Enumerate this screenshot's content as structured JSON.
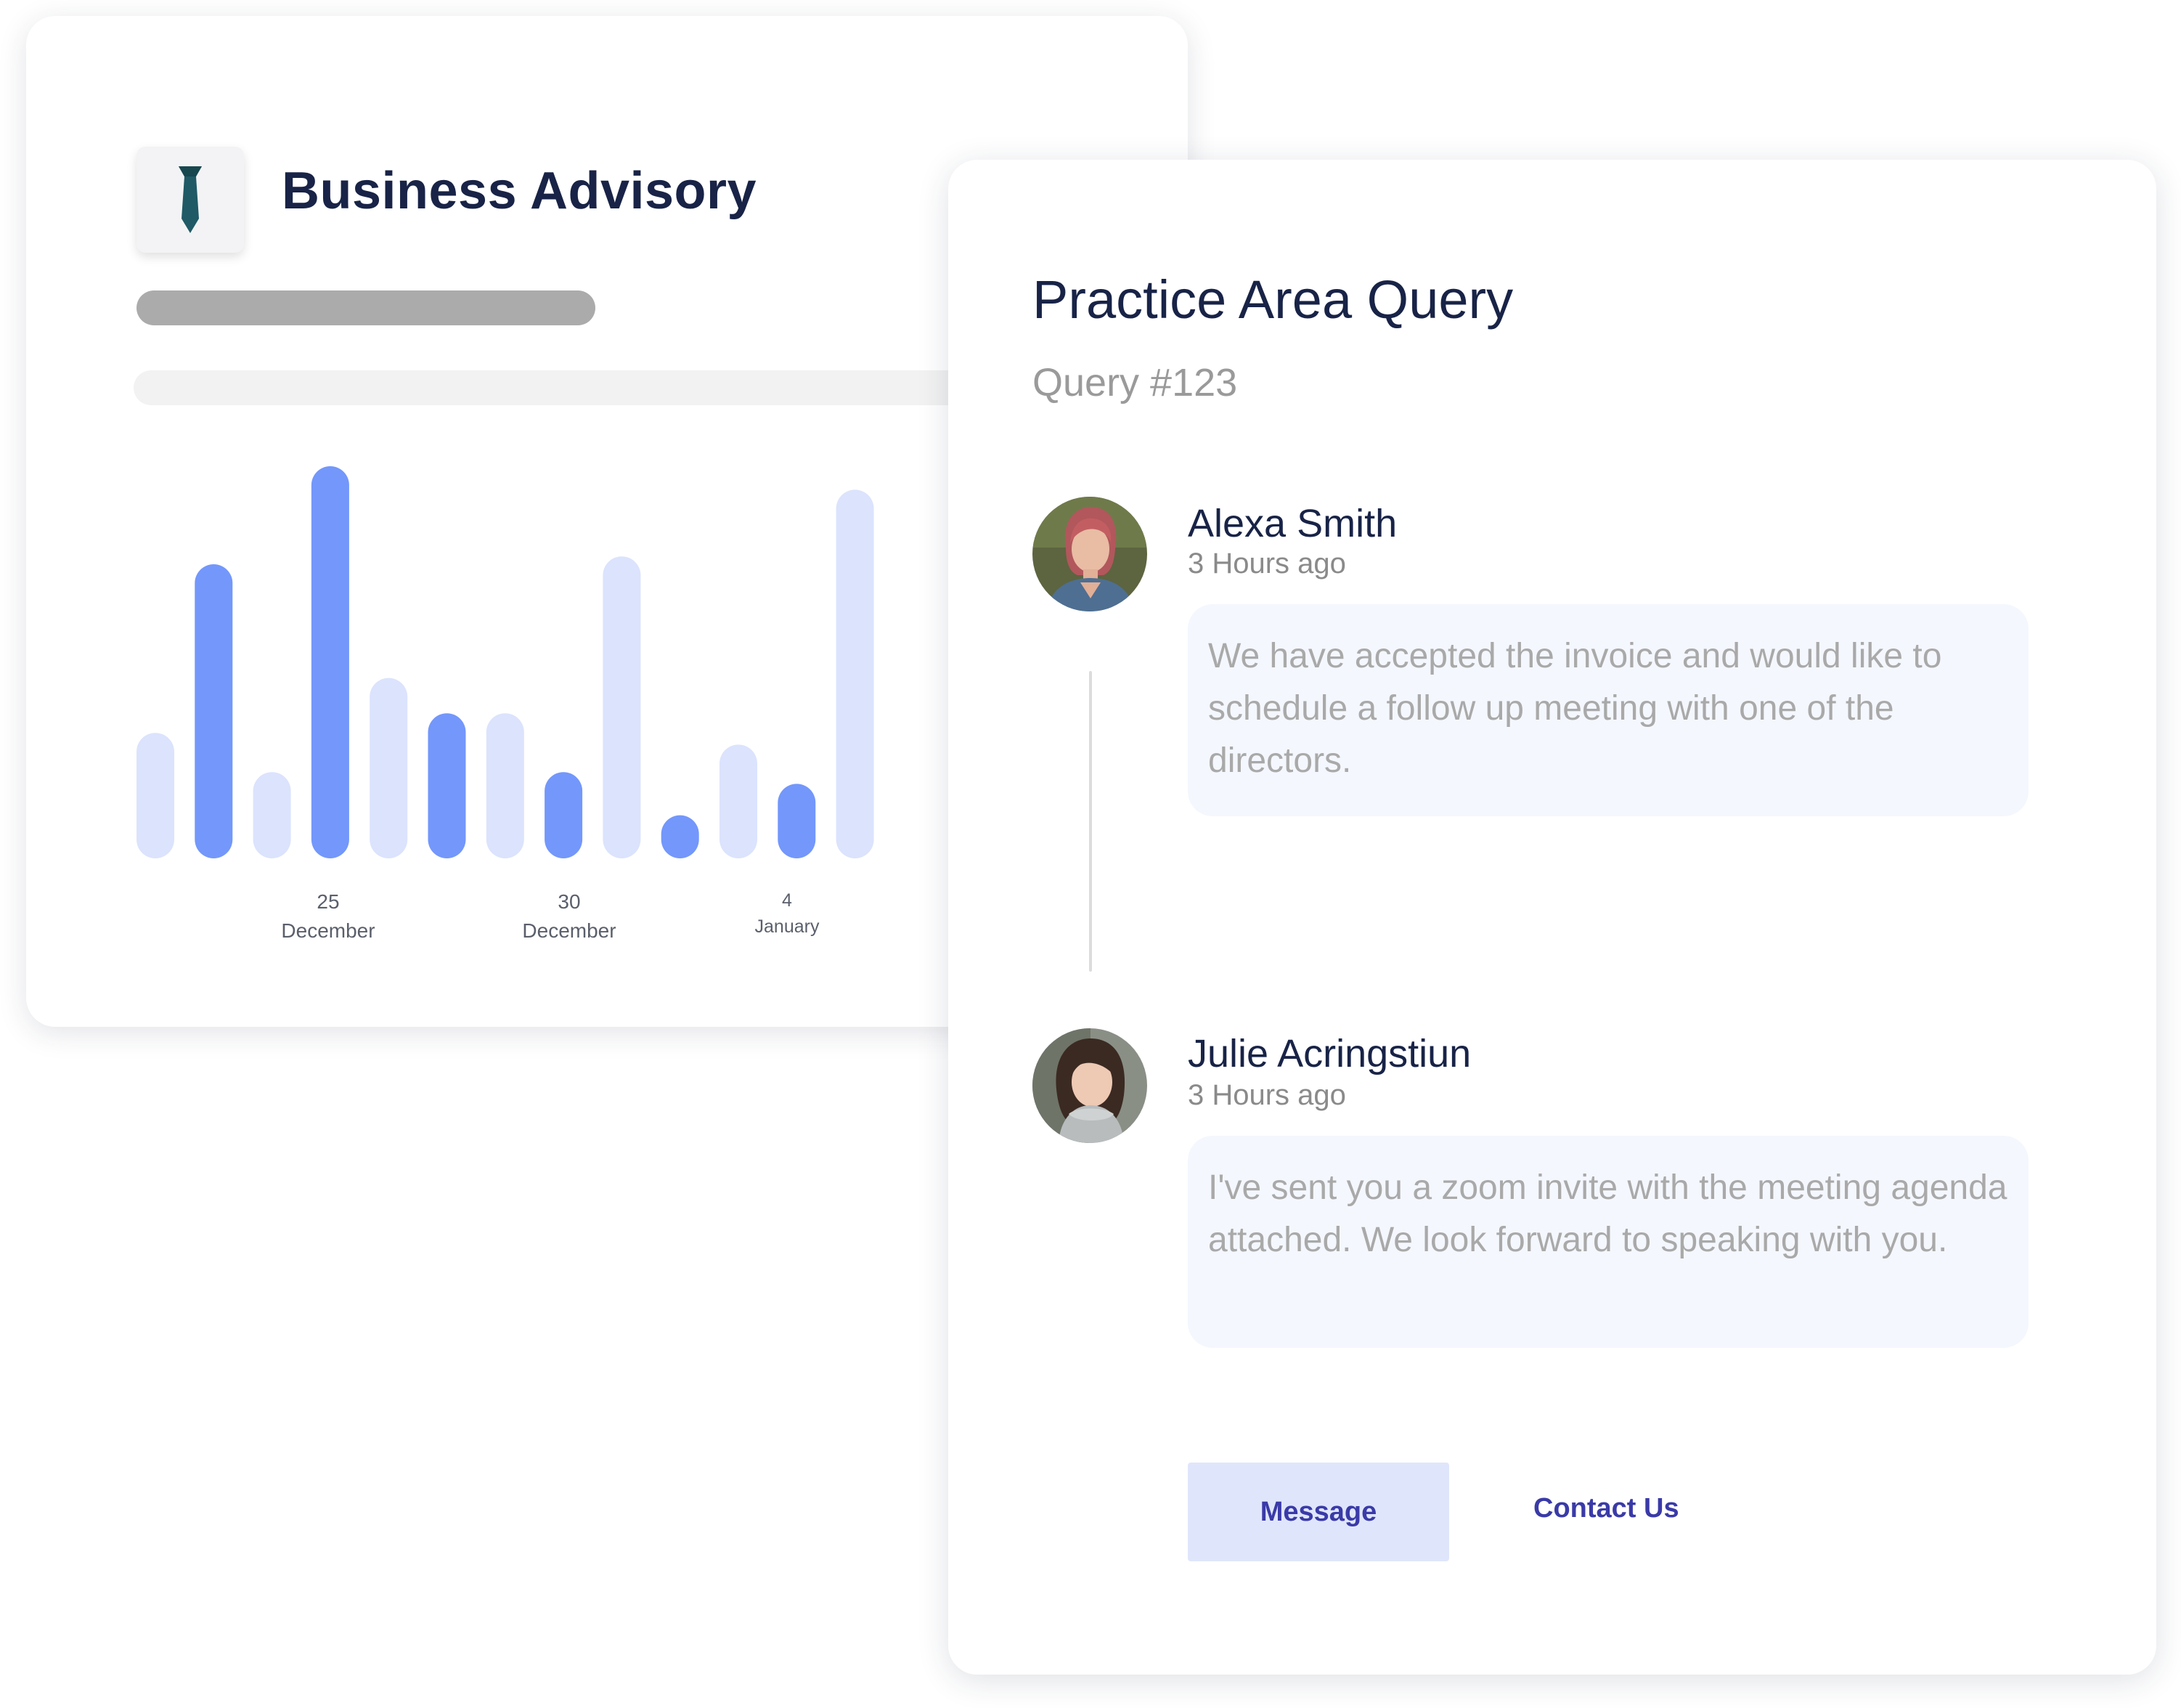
{
  "advisory": {
    "title": "Business Advisory",
    "icon": "tie-icon"
  },
  "chart_data": {
    "type": "bar",
    "title": "",
    "xlabel": "",
    "ylabel": "",
    "ylim": [
      0,
      100
    ],
    "grid": false,
    "colors": {
      "dark": "#7397fb",
      "light": "#dbe3fd"
    },
    "values": [
      32,
      75,
      22,
      100,
      46,
      37,
      37,
      22,
      77,
      11,
      29,
      19,
      94
    ],
    "shades": [
      "light",
      "dark",
      "light",
      "dark",
      "light",
      "dark",
      "light",
      "dark",
      "light",
      "dark",
      "light",
      "dark",
      "light"
    ],
    "tick_labels": [
      {
        "day": "25",
        "month": "December"
      },
      {
        "day": "30",
        "month": "December"
      },
      {
        "day": "4",
        "month": "January"
      }
    ]
  },
  "query": {
    "title": "Practice Area Query",
    "id_label": "Query #123",
    "messages": [
      {
        "author": "Alexa Smith",
        "time": "3 Hours ago",
        "text": "We have accepted the invoice and would like to schedule a follow up meeting with one of the directors."
      },
      {
        "author": "Julie Acringstiun",
        "time": "3 Hours ago",
        "text": "I've sent you a zoom invite with the meeting agenda attached. We look forward to speaking with you."
      }
    ],
    "message_button": "Message",
    "contact_link": "Contact Us"
  }
}
